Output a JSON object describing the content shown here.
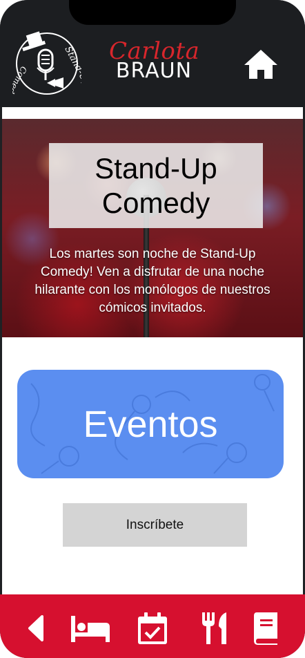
{
  "header": {
    "logo_text": "Stand-Up Comedy",
    "brand_script": "Carlota",
    "brand_block": "BRAUN",
    "home_icon": "home-icon"
  },
  "hero": {
    "title_line1": "Stand-Up",
    "title_line2": "Comedy",
    "description": "Los martes son noche de Stand-Up Comedy! Ven a disfrutar de una noche hilarante con los monólogos de nuestros cómicos invitados."
  },
  "events": {
    "label": "Eventos",
    "color": "#5b8ef0"
  },
  "signup": {
    "label": "Inscríbete"
  },
  "footer": {
    "color": "#d6102f",
    "items": [
      {
        "icon": "back-icon"
      },
      {
        "icon": "bed-icon"
      },
      {
        "icon": "calendar-check-icon"
      },
      {
        "icon": "utensils-icon"
      },
      {
        "icon": "book-icon"
      }
    ]
  }
}
